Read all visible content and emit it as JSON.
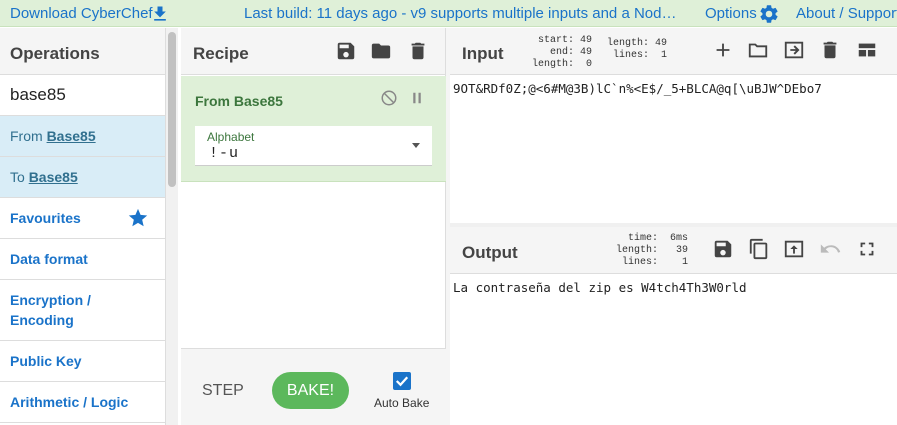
{
  "banner": {
    "download": "Download CyberChef",
    "build": "Last build: 11 days ago - v9 supports multiple inputs and a Nod…",
    "options": "Options",
    "about": "About / Support"
  },
  "operations": {
    "title": "Operations",
    "search": "base85",
    "results": [
      {
        "prefix": "From ",
        "name": "Base85"
      },
      {
        "prefix": "To ",
        "name": "Base85"
      }
    ],
    "categories": [
      "Favourites",
      "Data format",
      "Encryption / Encoding",
      "Public Key",
      "Arithmetic / Logic"
    ]
  },
  "recipe": {
    "title": "Recipe",
    "operation": "From Base85",
    "alphabet_label": "Alphabet",
    "alphabet_value": "!-u",
    "step": "STEP",
    "bake": "BAKE!",
    "autobake": "Auto Bake"
  },
  "input": {
    "title": "Input",
    "stats_left": "start: 49\n  end: 49\nlength:  0",
    "stats_right": "length: 49\n lines:  1",
    "text": "9OT&RDf0Z;@<6#M@3B)lC`n%<E$/_5+BLCA@q[\\uBJW^DEbo7"
  },
  "output": {
    "title": "Output",
    "stats": "  time:  6ms\nlength:   39\n lines:    1",
    "text": "La contraseña del zip es W4tch4Th3W0rld"
  },
  "colors": {
    "accent": "#1a73c9",
    "banner_bg": "#dff0d8",
    "bake": "#5cb85c"
  }
}
